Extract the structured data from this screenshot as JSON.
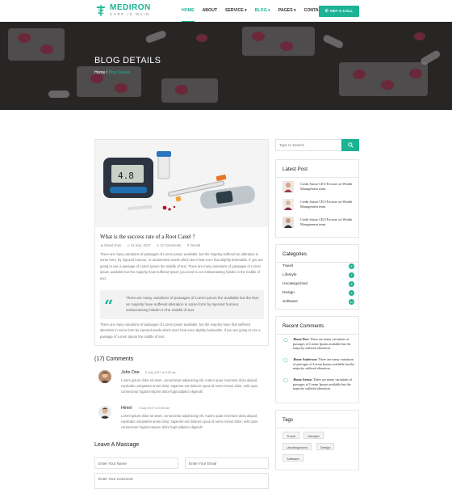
{
  "brand": {
    "name": "MEDIRON",
    "tagline": "CARE IS MAIN",
    "accent": "#1bb394"
  },
  "nav": {
    "items": [
      {
        "label": "HOME",
        "active": true
      },
      {
        "label": "ABOUT"
      },
      {
        "label": "SERVICE ▾"
      },
      {
        "label": "BLOG ▾"
      },
      {
        "label": "PAGES ▾"
      },
      {
        "label": "CONTACT"
      }
    ],
    "cta": "GET A CALL",
    "cta_icon": "phone-icon"
  },
  "hero": {
    "title": "BLOG DETAILS",
    "crumb_home": "Home",
    "crumb_sep": "/",
    "crumb_current": "Blog Details"
  },
  "post": {
    "title": "What is the success rate of a Root Canel ?",
    "meta": {
      "author": "David Jhon",
      "date": "11 Sep, 2017",
      "comments": "12 Comments",
      "category": "Dental"
    },
    "para1": "There are many variations of passages of Lorem Ipsum available, but the majority suffered an alteration in some form, by injected humour, or randomised words which don't look even that slightly believable. If you are going to use a passage of Lorem Ipsum the middle of text. There are many variations of passages of Lorem Ipsum available but the majority have suffered Ipsum you need to our embarrassing hidden in the middle of text.",
    "quote": "There are many variations of passages of Lorem Ipsum the available but the that as majority have suffered alteration in some form by injected humour, embarrassing hidden in the middle of text.",
    "para2": "There are many variations of passages of Lorem Ipsum available, but the majority have that suffered alteration in some form by injected words which don't look even slightly believable. If you are going to use a passage of Lorem Ipsum the middle of text."
  },
  "comments": {
    "heading": "(17) Comments",
    "items": [
      {
        "name": "John Doe",
        "date": "8 July 2017 at 9:50 am",
        "text": "Lorem ipsum dolor sit amet, consectetur adipisicing elit. Autem quae inventore dicta aliquid, explicabo voluptates animi dolor, sapiente est dolorem quas id nemo minus dolor, velit quos consectetur fugiat tempore dolor fugit adipisci eligendi!"
      },
      {
        "name": "Himel",
        "date": "8 July 2017 at 9:50 am",
        "text": "Lorem ipsum dolor sit amet, consectetur adipisicing elit. Autem quae inventore dicta aliquid, explicabo voluptates animi dolor, sapiente est dolorem quas id nemo minus dolor, velit quos consectetur fugiat tempore dolor fugit adipisci eligendi!"
      }
    ]
  },
  "form": {
    "heading": "Leave A Massage",
    "name_placeholder": "Enter Your Name",
    "email_placeholder": "Enter Your Email",
    "comment_placeholder": "Enter Your Comment"
  },
  "sidebar": {
    "search_placeholder": "Type to Search",
    "latest_title": "Latest Post",
    "latest": [
      {
        "text": "Credit Suisse CEO Focuses on Wealth Management team."
      },
      {
        "text": "Credit Suisse CEO Focuses on Wealth Management team."
      },
      {
        "text": "Credit Suisse CEO Focuses on Wealth Management team."
      }
    ],
    "categories_title": "Categories",
    "categories": [
      {
        "label": "Travel",
        "count": "6"
      },
      {
        "label": "Lifestyle",
        "count": "7"
      },
      {
        "label": "Uncategorized",
        "count": "8"
      },
      {
        "label": "Design",
        "count": "9"
      },
      {
        "label": "Software",
        "count": "10"
      }
    ],
    "recent_title": "Recent Comments",
    "recent": [
      {
        "name": "Jhone Doe:",
        "text": "There are many variations of passages of Lorem Ipsum available but the majority suffered alteration."
      },
      {
        "name": "Jhone Anderson:",
        "text": "There are many variations of passages of Lorem Ipsum available but the majority suffered alteration."
      },
      {
        "name": "Jhone Arena:",
        "text": "There are many variations of passages of Lorem Ipsum available but the majority suffered alteration."
      }
    ],
    "tags_title": "Tags",
    "tags": [
      "Travel",
      "Lifestyle",
      "Uncategorized",
      "Design",
      "Software"
    ]
  }
}
